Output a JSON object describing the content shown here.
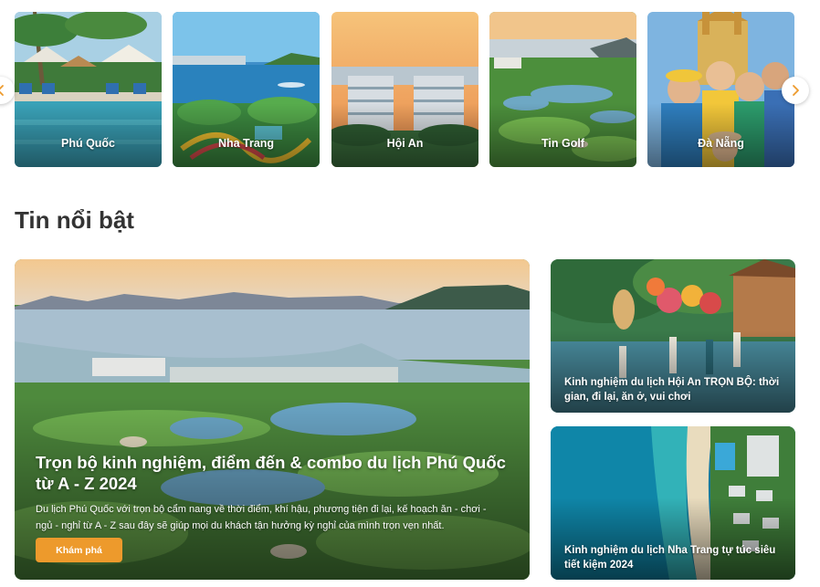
{
  "destinations": {
    "items": [
      {
        "label": "Phú Quốc",
        "image": "resort-pool-beach-image"
      },
      {
        "label": "Nha Trang",
        "image": "coastal-city-waterpark-image"
      },
      {
        "label": "Hội An",
        "image": "sunset-resort-towers-image"
      },
      {
        "label": "Tin Golf",
        "image": "golf-course-lagoon-image"
      },
      {
        "label": "Đà Nẵng",
        "image": "group-selfie-castle-image"
      }
    ],
    "prev_icon": "chevron-left-icon",
    "next_icon": "chevron-right-icon"
  },
  "news": {
    "heading": "Tin nổi bật",
    "featured": {
      "title": "Trọn bộ kinh nghiệm, điểm đến & combo du lịch Phú Quốc từ A - Z 2024",
      "description": "Du lịch Phú Quốc với trọn bộ cẩm nang về thời điểm, khí hậu, phương tiện đi lại, kế hoạch ăn - chơi - ngủ - nghỉ từ A - Z sau đây sẽ giúp mọi du khách tận hưởng kỳ nghỉ của mình trọn vẹn nhất.",
      "button_label": "Khám phá",
      "image": "bay-golf-aerial-image"
    },
    "side": [
      {
        "title": "Kinh nghiệm du lịch Hội An TRỌN BỘ: thời gian, đi lại, ăn ở, vui chơi",
        "image": "hoi-an-lantern-dancers-image"
      },
      {
        "title": "Kinh nghiệm du lịch Nha Trang tự túc siêu tiết kiệm 2024",
        "image": "aerial-beach-resort-image"
      }
    ]
  },
  "colors": {
    "accent": "#ed9a2c",
    "heading": "#333333",
    "arrow_icon": "#ed9a2c"
  }
}
